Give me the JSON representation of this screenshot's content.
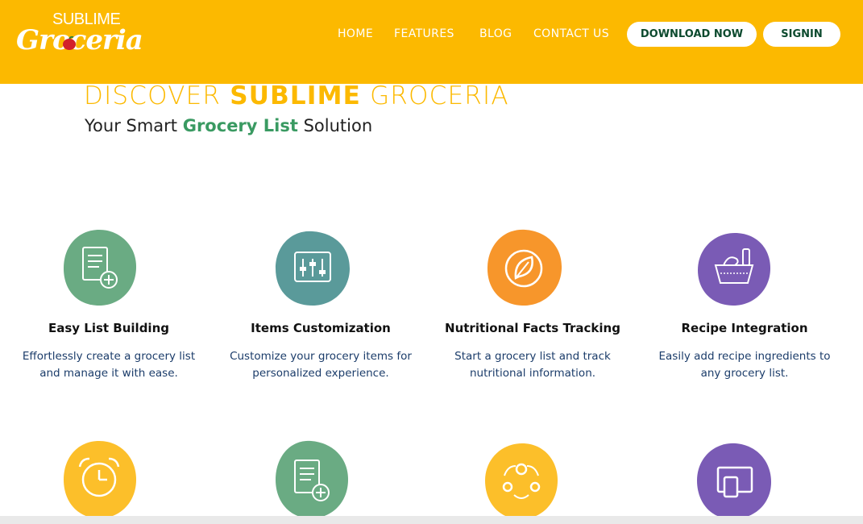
{
  "brand": {
    "logo_top": "SUBLIME",
    "logo_main": "Groceria"
  },
  "nav": {
    "home": "HOME",
    "features": "FEATURES",
    "blog": "BLOG",
    "contact": "CONTACT US",
    "download": "DOWNLOAD NOW",
    "signin": "SIGNIN"
  },
  "hero": {
    "title_pre": "DISCOVER ",
    "title_bold": "SUBLIME",
    "title_post": " GROCERIA",
    "sub_pre": "Your Smart ",
    "sub_bold": "Grocery List",
    "sub_post": " Solution"
  },
  "features": [
    {
      "title": "Easy List Building",
      "line1": "Effortlessly create a grocery list",
      "line2": "and manage it with ease.",
      "icon": "list-add-icon",
      "color": "#6aab83"
    },
    {
      "title": "Items Customization",
      "line1": "Customize your grocery items for",
      "line2": "personalized experience.",
      "icon": "sliders-icon",
      "color": "#5a9a9a"
    },
    {
      "title": "Nutritional Facts Tracking",
      "line1": "Start a grocery list and track",
      "line2": "nutritional information.",
      "icon": "leaf-icon",
      "color": "#f7962b"
    },
    {
      "title": "Recipe Integration",
      "line1": "Easily add recipe ingredients to",
      "line2": "any grocery list.",
      "icon": "basket-icon",
      "color": "#7a5bb5"
    }
  ],
  "features_row2": [
    {
      "icon": "alarm-clock-icon",
      "color": "#fcbf2a"
    },
    {
      "icon": "list-add-icon",
      "color": "#6aab83"
    },
    {
      "icon": "people-network-icon",
      "color": "#fcbf2a"
    },
    {
      "icon": "devices-icon",
      "color": "#7a5bb5"
    }
  ]
}
